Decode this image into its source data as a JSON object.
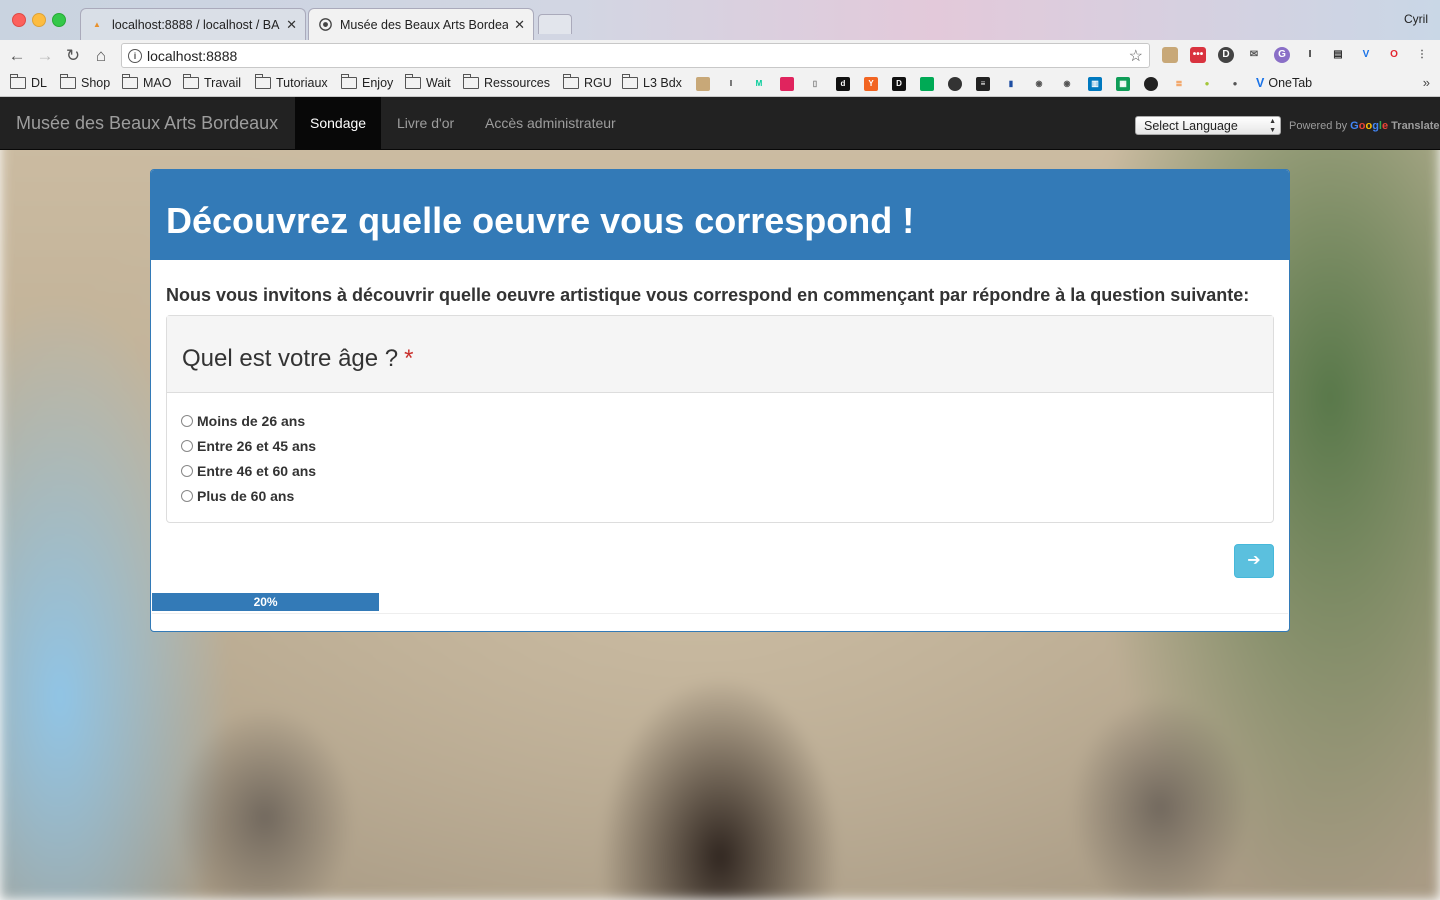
{
  "browser": {
    "tabs": [
      {
        "label": "localhost:8888 / localhost / BA",
        "favicon": "phpmyadmin-icon",
        "active": false
      },
      {
        "label": "Musée des Beaux Arts Bordeaux",
        "favicon": "github-icon",
        "active": true
      }
    ],
    "user": "Cyril",
    "url": "localhost:8888",
    "bookmarks": [
      {
        "label": "DL"
      },
      {
        "label": "Shop"
      },
      {
        "label": "MAO"
      },
      {
        "label": "Travail"
      },
      {
        "label": "Tutoriaux"
      },
      {
        "label": "Enjoy"
      },
      {
        "label": "Wait"
      },
      {
        "label": "Ressources"
      },
      {
        "label": "RGU"
      },
      {
        "label": "L3 Bdx"
      }
    ],
    "onetab_label": "OneTab"
  },
  "navbar": {
    "brand": "Musée des Beaux Arts Bordeaux",
    "items": [
      {
        "label": "Sondage",
        "active": true
      },
      {
        "label": "Livre d'or",
        "active": false
      },
      {
        "label": "Accès administrateur",
        "active": false
      }
    ],
    "language_select": "Select Language",
    "powered_by": "Powered by",
    "google": "Google",
    "translate": "Translate"
  },
  "survey": {
    "title": "Découvrez quelle oeuvre vous correspond !",
    "intro": "Nous vous invitons à découvrir quelle oeuvre artistique vous correspond en commençant par répondre à la question suivante:",
    "question": "Quel est votre âge ?",
    "required_mark": "*",
    "options": [
      "Moins de 26 ans",
      "Entre 26 et 45 ans",
      "Entre 46 et 60 ans",
      "Plus de 60 ans"
    ],
    "next_icon": "arrow-right-icon",
    "progress_percent": 20,
    "progress_label": "20%"
  },
  "colors": {
    "primary": "#337ab7",
    "info_button": "#5bc0de",
    "navbar": "#222222",
    "required": "#c9302c"
  }
}
